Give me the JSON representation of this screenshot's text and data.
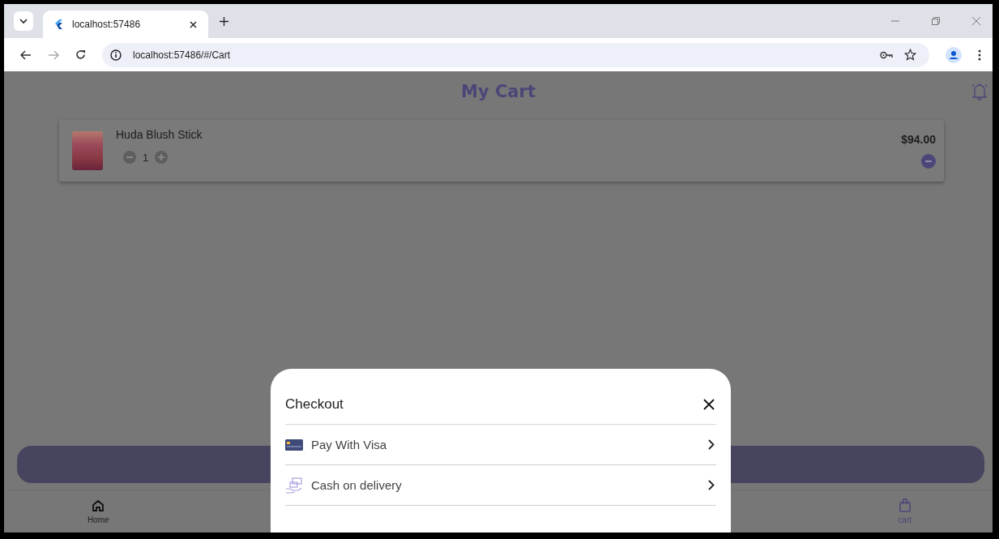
{
  "browser": {
    "tabs": [
      {
        "title": "localhost:57486",
        "selected": true
      }
    ],
    "address": "localhost:57486/#/Cart"
  },
  "page": {
    "title": "My Cart"
  },
  "cart_items": [
    {
      "name": "Huda Blush Stick",
      "quantity": "1",
      "price": "$94.00"
    }
  ],
  "bottom_nav": [
    {
      "label": "Home",
      "selected": false
    },
    {
      "label": "cart",
      "selected": true
    }
  ],
  "checkout_sheet": {
    "title": "Checkout",
    "options": [
      {
        "label": "Pay With Visa"
      },
      {
        "label": "Cash on delivery"
      }
    ]
  }
}
